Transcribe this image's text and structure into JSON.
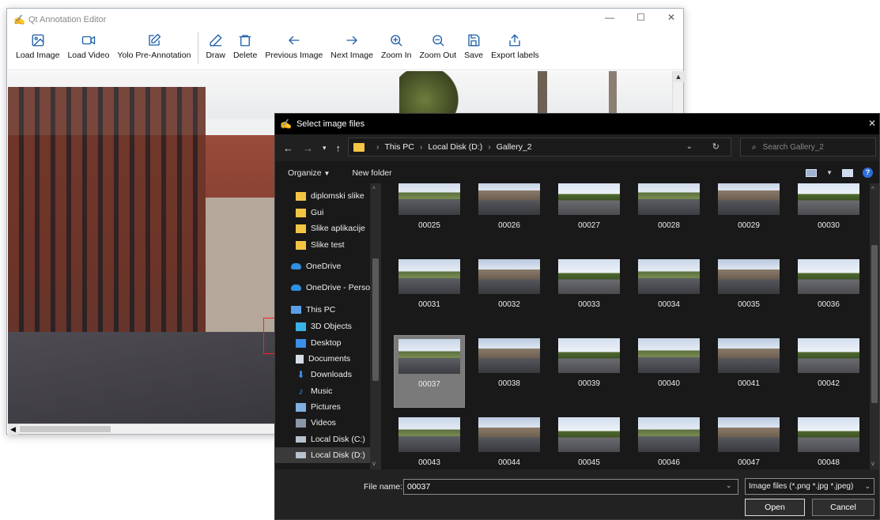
{
  "main": {
    "title": "Qt Annotation Editor",
    "toolbar": [
      {
        "id": "load-image",
        "label": "Load Image"
      },
      {
        "id": "load-video",
        "label": "Load Video"
      },
      {
        "id": "yolo",
        "label": "Yolo Pre-Annotation"
      },
      {
        "id": "draw",
        "label": "Draw"
      },
      {
        "id": "delete",
        "label": "Delete"
      },
      {
        "id": "prev",
        "label": "Previous Image"
      },
      {
        "id": "next",
        "label": "Next Image"
      },
      {
        "id": "zoom-in",
        "label": "Zoom In"
      },
      {
        "id": "zoom-out",
        "label": "Zoom Out"
      },
      {
        "id": "save",
        "label": "Save"
      },
      {
        "id": "export",
        "label": "Export labels"
      }
    ]
  },
  "dialog": {
    "title": "Select image files",
    "breadcrumb": [
      "This PC",
      "Local Disk (D:)",
      "Gallery_2"
    ],
    "search_placeholder": "Search Gallery_2",
    "organize_label": "Organize",
    "new_folder_label": "New folder",
    "nav_items": [
      {
        "label": "diplomski slike",
        "icon": "folder-icon"
      },
      {
        "label": "Gui",
        "icon": "folder-icon"
      },
      {
        "label": "Slike aplikacije",
        "icon": "folder-icon"
      },
      {
        "label": "Slike test",
        "icon": "folder-icon"
      },
      {
        "label": "OneDrive",
        "icon": "cloud-icon"
      },
      {
        "label": "OneDrive - Persor",
        "icon": "cloud-icon"
      },
      {
        "label": "This PC",
        "icon": "computer-icon"
      },
      {
        "label": "3D Objects",
        "icon": "cube-icon"
      },
      {
        "label": "Desktop",
        "icon": "desktop-icon"
      },
      {
        "label": "Documents",
        "icon": "document-icon"
      },
      {
        "label": "Downloads",
        "icon": "download-icon"
      },
      {
        "label": "Music",
        "icon": "music-icon"
      },
      {
        "label": "Pictures",
        "icon": "pictures-icon"
      },
      {
        "label": "Videos",
        "icon": "video-icon"
      },
      {
        "label": "Local Disk (C:)",
        "icon": "drive-icon"
      },
      {
        "label": "Local Disk (D:)",
        "icon": "drive-icon"
      }
    ],
    "files": [
      "00025",
      "00026",
      "00027",
      "00028",
      "00029",
      "00030",
      "00031",
      "00032",
      "00033",
      "00034",
      "00035",
      "00036",
      "00037",
      "00038",
      "00039",
      "00040",
      "00041",
      "00042",
      "00043",
      "00044",
      "00045",
      "00046",
      "00047",
      "00048"
    ],
    "selected_file": "00037",
    "file_name_label": "File name:",
    "file_name_value": "00037",
    "file_type": "Image files (*.png *.jpg *.jpeg)",
    "open_label": "Open",
    "cancel_label": "Cancel"
  }
}
